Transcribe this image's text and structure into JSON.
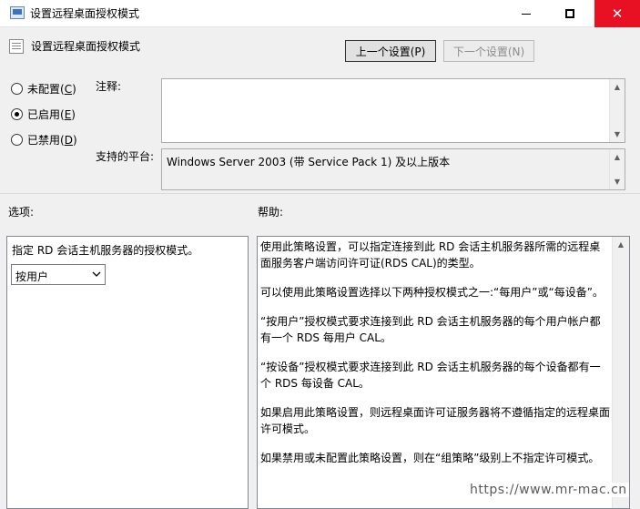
{
  "window": {
    "title": "设置远程桌面授权模式",
    "minimize_label": "",
    "maximize_label": "",
    "close_label": "✕"
  },
  "policy": {
    "name": "设置远程桌面授权模式",
    "prev_button": "上一个设置(P)",
    "next_button": "下一个设置(N)"
  },
  "state": {
    "not_configured": "未配置",
    "not_configured_key": "C",
    "enabled": "已启用",
    "enabled_key": "E",
    "disabled": "已禁用",
    "disabled_key": "D",
    "selected": "enabled"
  },
  "comment": {
    "label": "注释:",
    "value": ""
  },
  "platform": {
    "label": "支持的平台:",
    "value": "Windows Server 2003 (带 Service Pack 1) 及以上版本"
  },
  "options": {
    "label": "选项:",
    "description": "指定 RD 会话主机服务器的授权模式。",
    "mode_selected": "按用户"
  },
  "help": {
    "label": "帮助:",
    "paragraphs": [
      "使用此策略设置，可以指定连接到此 RD 会话主机服务器所需的远程桌面服务客户端访问许可证(RDS CAL)的类型。",
      "可以使用此策略设置选择以下两种授权模式之一:“每用户”或“每设备”。",
      "“按用户”授权模式要求连接到此 RD 会话主机服务器的每个用户帐户都有一个 RDS 每用户 CAL。",
      "“按设备”授权模式要求连接到此 RD 会话主机服务器的每个设备都有一个 RDS 每设备 CAL。",
      "如果启用此策略设置，则远程桌面许可证服务器将不遵循指定的远程桌面许可模式。",
      "如果禁用或未配置此策略设置，则在“组策略”级别上不指定许可模式。"
    ]
  },
  "watermark": "https://www.mr-mac.cn",
  "colors": {
    "close_button": "#e81123",
    "window_bg": "#f0f0f0"
  }
}
